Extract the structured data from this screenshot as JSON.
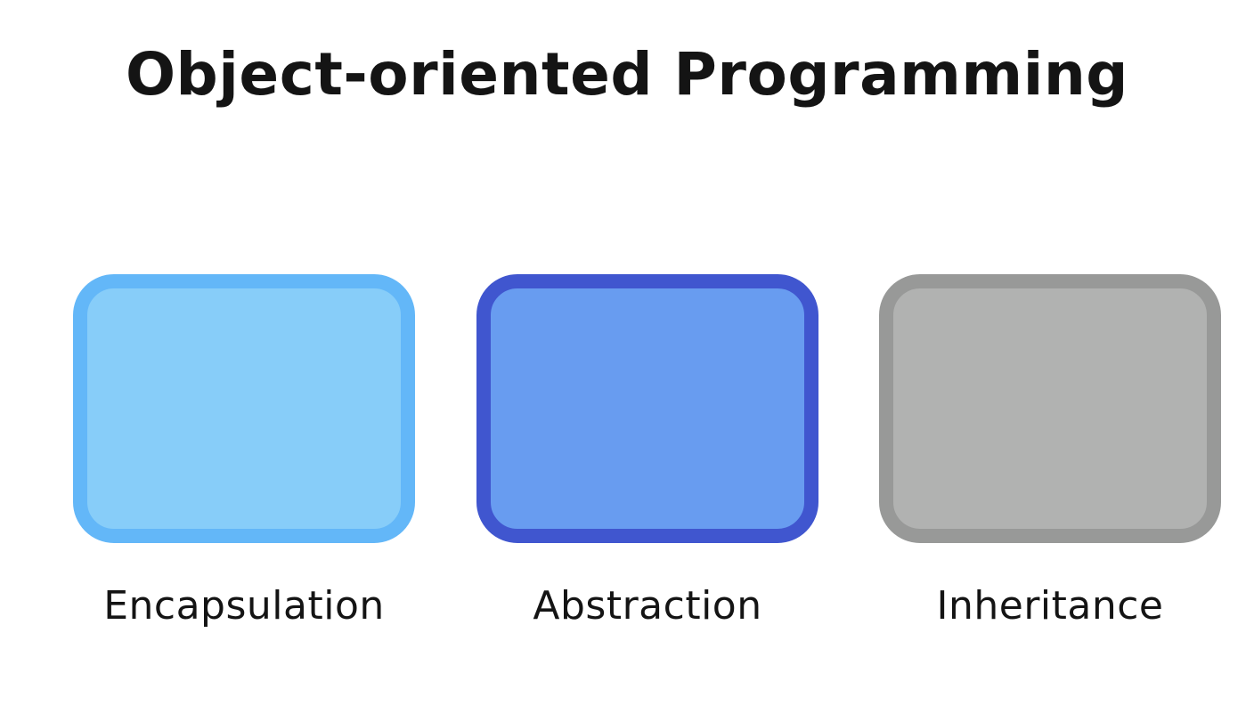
{
  "title": "Object-oriented Programming",
  "concepts": [
    {
      "label": "Encapsulation",
      "fill": "#87CDF9",
      "border": "#63B7F8"
    },
    {
      "label": "Abstraction",
      "fill": "#689CF0",
      "border": "#4056CF"
    },
    {
      "label": "Inheritance",
      "fill": "#B1B2B1",
      "border": "#989998"
    }
  ]
}
